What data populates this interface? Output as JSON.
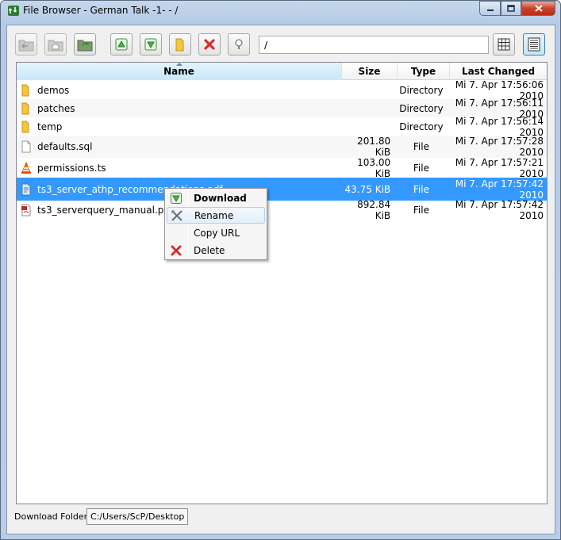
{
  "window": {
    "title": "File Browser - German Talk -1- - /"
  },
  "toolbar": {
    "buttons": [
      {
        "name": "back-button",
        "icon": "folder-back-icon"
      },
      {
        "name": "home-button",
        "icon": "folder-home-icon"
      },
      {
        "name": "refresh-button",
        "icon": "folder-refresh-icon"
      },
      {
        "name": "upload-button",
        "icon": "upload-icon"
      },
      {
        "name": "download-button",
        "icon": "download-icon"
      },
      {
        "name": "new-folder-button",
        "icon": "new-folder-icon"
      },
      {
        "name": "delete-button",
        "icon": "delete-icon"
      },
      {
        "name": "rename-button",
        "icon": "rename-icon"
      }
    ],
    "path_value": "/",
    "view_icons_label": "icon-view",
    "view_details_label": "details-view"
  },
  "columns": [
    "Name",
    "Size",
    "Type",
    "Last Changed"
  ],
  "files": [
    {
      "name": "demos",
      "size": "",
      "type": "Directory",
      "changed": "Mi 7. Apr 17:56:06 2010",
      "icon": "folder-icon"
    },
    {
      "name": "patches",
      "size": "",
      "type": "Directory",
      "changed": "Mi 7. Apr 17:56:11 2010",
      "icon": "folder-icon"
    },
    {
      "name": "temp",
      "size": "",
      "type": "Directory",
      "changed": "Mi 7. Apr 17:56:14 2010",
      "icon": "folder-icon"
    },
    {
      "name": "defaults.sql",
      "size": "201.80 KiB",
      "type": "File",
      "changed": "Mi 7. Apr 17:57:28 2010",
      "icon": "file-icon"
    },
    {
      "name": "permissions.ts",
      "size": "103.00 KiB",
      "type": "File",
      "changed": "Mi 7. Apr 17:57:21 2010",
      "icon": "vlc-cone-icon"
    },
    {
      "name": "ts3_server_athp_recommendations.pdf",
      "size": "43.75 KiB",
      "type": "File",
      "changed": "Mi 7. Apr 17:57:42 2010",
      "icon": "document-icon"
    },
    {
      "name": "ts3_serverquery_manual.pdf",
      "size": "892.84 KiB",
      "type": "File",
      "changed": "Mi 7. Apr 17:57:42 2010",
      "icon": "pdf-icon"
    }
  ],
  "context_menu": {
    "items": [
      {
        "label": "Download",
        "icon": "download-icon"
      },
      {
        "label": "Rename",
        "icon": "rename-tools-icon"
      },
      {
        "label": "Copy URL",
        "icon": ""
      },
      {
        "label": "Delete",
        "icon": "delete-icon"
      }
    ]
  },
  "footer": {
    "label": "Download Folder:",
    "path": "C:/Users/ScP/Desktop"
  },
  "colors": {
    "selection": "#3399ff",
    "accent": "#5b86ab"
  }
}
